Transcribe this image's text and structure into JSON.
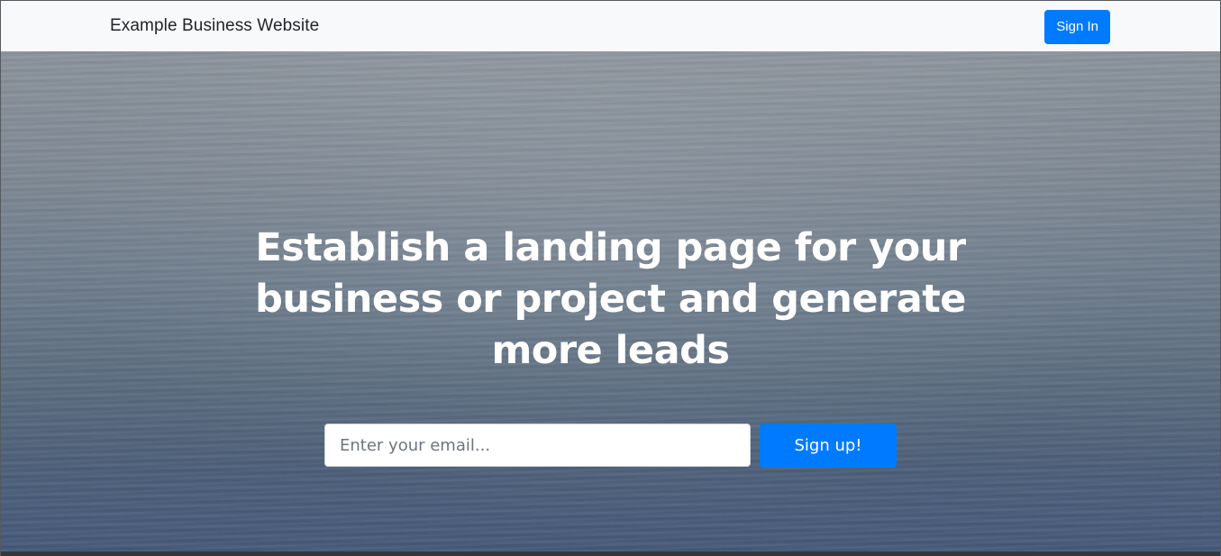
{
  "navbar": {
    "brand": "Example Business Website",
    "signin_label": "Sign In"
  },
  "hero": {
    "headline": "Establish a landing page for your business or project and generate more leads",
    "email_placeholder": "Enter your email...",
    "signup_label": "Sign up!"
  },
  "colors": {
    "primary": "#007bff",
    "navbar_bg": "#f8f9fa",
    "text_dark": "#212529",
    "hero_text": "#ffffff"
  },
  "icons": []
}
